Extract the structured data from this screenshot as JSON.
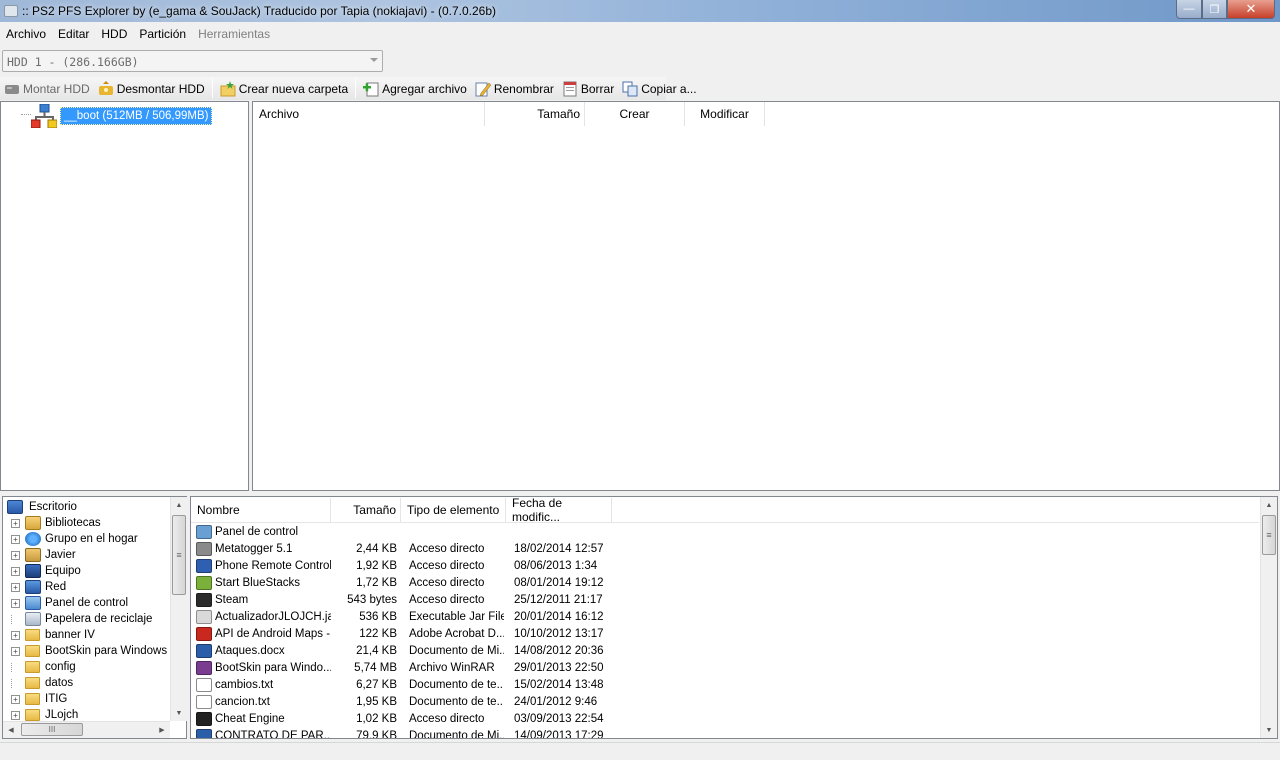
{
  "window": {
    "title": ":: PS2 PFS Explorer by (e_gama & SouJack) Traducido por Tapia (nokiajavi) - (0.7.0.26b)",
    "min_glyph": "—",
    "max_glyph": "❐",
    "close_glyph": "✕"
  },
  "menu": [
    "Archivo",
    "Editar",
    "HDD",
    "Partición",
    "Herramientas"
  ],
  "hdd": {
    "selected": "HDD 1 - (286.166GB)"
  },
  "toolbar": {
    "mount": "Montar HDD",
    "unmount": "Desmontar HDD",
    "new_folder": "Crear nueva carpeta",
    "add_file": "Agregar archivo",
    "rename": "Renombrar",
    "delete": "Borrar",
    "copy_to": "Copiar a..."
  },
  "ps2_tree": {
    "node": "__boot (512MB / 506,99MB)"
  },
  "ps2_list": {
    "columns": [
      "Archivo",
      "Tamaño",
      "Crear",
      "Modificar"
    ]
  },
  "local_tree": {
    "root": "Escritorio",
    "items": [
      {
        "label": "Bibliotecas",
        "icon": "libraries-icon",
        "expander": "+"
      },
      {
        "label": "Grupo en el hogar",
        "icon": "homegroup-icon",
        "expander": "+"
      },
      {
        "label": "Javier",
        "icon": "user-icon",
        "expander": "+"
      },
      {
        "label": "Equipo",
        "icon": "computer-icon",
        "expander": "+"
      },
      {
        "label": "Red",
        "icon": "network-icon",
        "expander": "+"
      },
      {
        "label": "Panel de control",
        "icon": "control-panel-icon",
        "expander": "+"
      },
      {
        "label": "Papelera de reciclaje",
        "icon": "recycle-bin-icon",
        "expander": ""
      },
      {
        "label": "banner IV",
        "icon": "folder-icon",
        "expander": "+"
      },
      {
        "label": "BootSkin para  Windows",
        "icon": "folder-icon",
        "expander": "+"
      },
      {
        "label": "config",
        "icon": "folder-icon",
        "expander": ""
      },
      {
        "label": "datos",
        "icon": "folder-icon",
        "expander": ""
      },
      {
        "label": "ITIG",
        "icon": "folder-icon",
        "expander": "+"
      },
      {
        "label": "JLojch",
        "icon": "folder-icon",
        "expander": "+"
      }
    ],
    "hscroll_thumb": "III"
  },
  "local_list": {
    "columns": [
      "Nombre",
      "Tamaño",
      "Tipo de elemento",
      "Fecha de modific..."
    ],
    "rows": [
      {
        "name": "Panel de control",
        "size": "",
        "type": "",
        "date": "",
        "icon": "control-panel-icon",
        "color": "#6a9fd4"
      },
      {
        "name": "Metatogger 5.1",
        "size": "2,44 KB",
        "type": "Acceso directo",
        "date": "18/02/2014 12:57",
        "icon": "metatogger-icon",
        "color": "#8a8a8a"
      },
      {
        "name": "Phone Remote Control",
        "size": "1,92 KB",
        "type": "Acceso directo",
        "date": "08/06/2013 1:34",
        "icon": "star-icon",
        "color": "#2f5fb0"
      },
      {
        "name": "Start BlueStacks",
        "size": "1,72 KB",
        "type": "Acceso directo",
        "date": "08/01/2014 19:12",
        "icon": "bluestacks-icon",
        "color": "#7bb03a"
      },
      {
        "name": "Steam",
        "size": "543 bytes",
        "type": "Acceso directo",
        "date": "25/12/2011 21:17",
        "icon": "steam-icon",
        "color": "#2b2b2b"
      },
      {
        "name": "ActualizadorJLOJCH.jar",
        "size": "536 KB",
        "type": "Executable Jar File",
        "date": "20/01/2014 16:12",
        "icon": "jar-icon",
        "color": "#d9d9d9"
      },
      {
        "name": "API de Android Maps -...",
        "size": "122 KB",
        "type": "Adobe Acrobat D...",
        "date": "10/10/2012 13:17",
        "icon": "pdf-icon",
        "color": "#c8281e"
      },
      {
        "name": "Ataques.docx",
        "size": "21,4 KB",
        "type": "Documento de Mi...",
        "date": "14/08/2012 20:36",
        "icon": "word-icon",
        "color": "#2b5ea8"
      },
      {
        "name": "BootSkin para  Windo...",
        "size": "5,74 MB",
        "type": "Archivo WinRAR",
        "date": "29/01/2013 22:50",
        "icon": "winrar-icon",
        "color": "#7a3c8f"
      },
      {
        "name": "cambios.txt",
        "size": "6,27 KB",
        "type": "Documento de te...",
        "date": "15/02/2014 13:48",
        "icon": "text-file-icon",
        "color": "#ffffff"
      },
      {
        "name": "cancion.txt",
        "size": "1,95 KB",
        "type": "Documento de te...",
        "date": "24/01/2012 9:46",
        "icon": "text-file-icon",
        "color": "#ffffff"
      },
      {
        "name": "Cheat Engine",
        "size": "1,02 KB",
        "type": "Acceso directo",
        "date": "03/09/2013 22:54",
        "icon": "gear-icon",
        "color": "#222222"
      },
      {
        "name": "CONTRATO DE PAR...",
        "size": "79,9 KB",
        "type": "Documento de Mi...",
        "date": "14/09/2013 17:29",
        "icon": "word-icon",
        "color": "#2b5ea8"
      }
    ]
  },
  "scroll_glyphs": {
    "up": "▲",
    "down": "▼",
    "left": "◀",
    "right": "▶",
    "grip": "≡"
  }
}
